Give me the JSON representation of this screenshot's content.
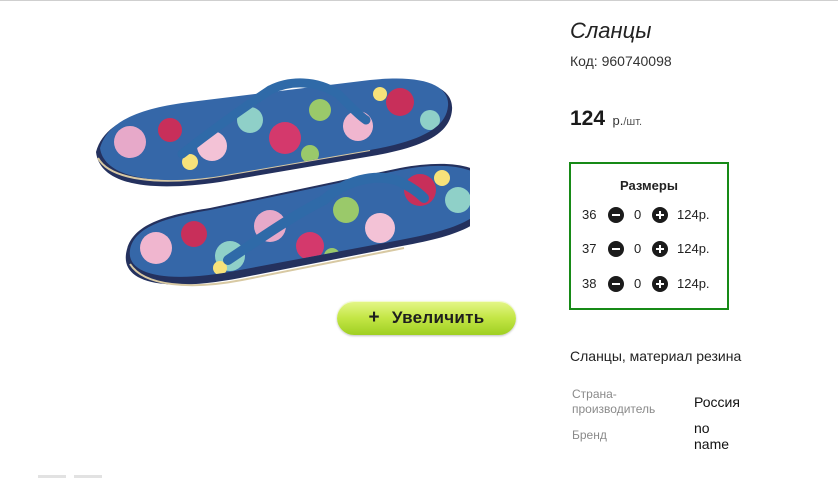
{
  "product": {
    "title": "Сланцы",
    "code_text": "Код: 960740098",
    "price": "124",
    "price_unit": "р.",
    "price_per": "/шт.",
    "description": "Сланцы, материал резина"
  },
  "gallery": {
    "zoom_label": "Увеличить",
    "zoom_icon": "+"
  },
  "sizes": {
    "title": "Размеры",
    "rows": [
      {
        "size": "36",
        "qty": "0",
        "price": "124р."
      },
      {
        "size": "37",
        "qty": "0",
        "price": "124р."
      },
      {
        "size": "38",
        "qty": "0",
        "price": "124р."
      }
    ]
  },
  "attributes": [
    {
      "label": "Страна-производитель",
      "value": "Россия"
    },
    {
      "label": "Бренд",
      "value": "no name"
    }
  ],
  "colors": {
    "sizes_border": "#178a17",
    "zoom_button": "#c3e645",
    "sandal_strap": "#2f6aa8",
    "sandal_sole": "#24315e"
  }
}
